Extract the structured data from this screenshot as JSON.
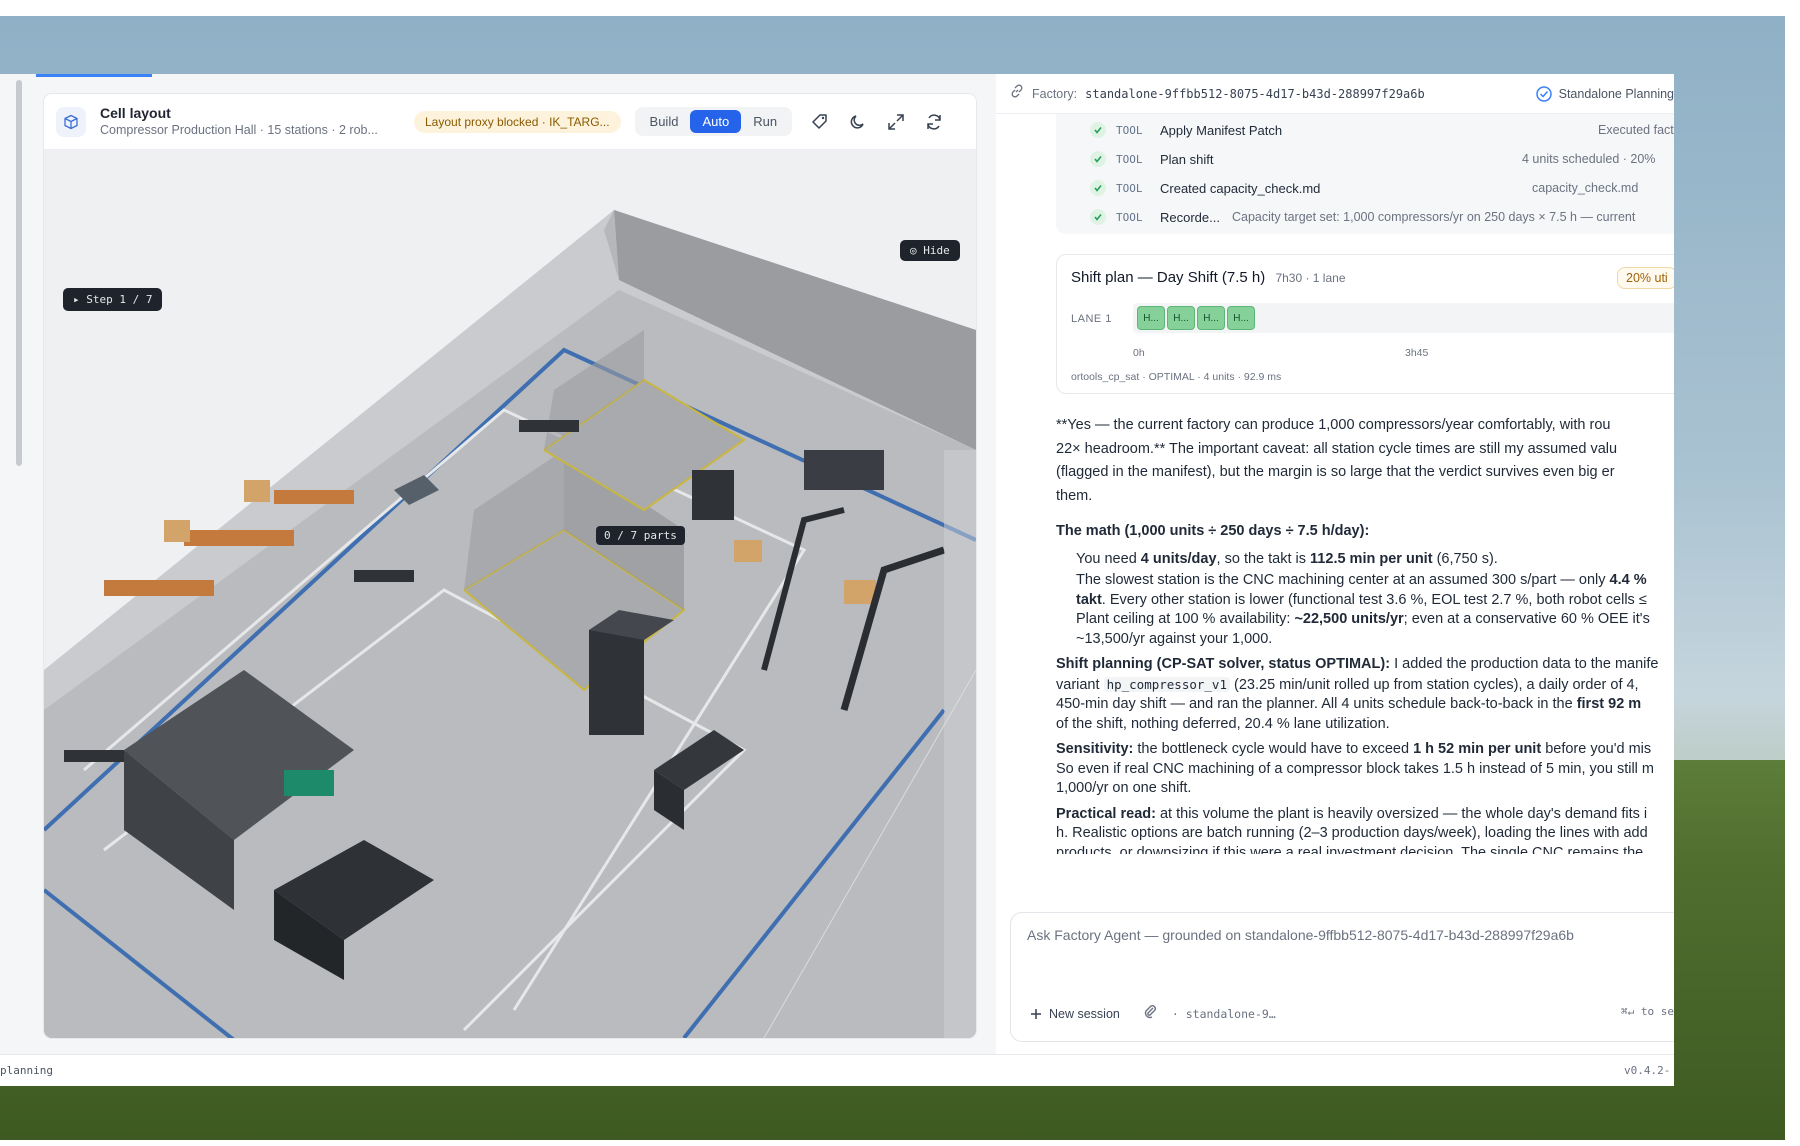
{
  "cell_layout": {
    "title": "Cell layout",
    "subtitle": "Compressor Production Hall · 15 stations · 2 rob...",
    "proxy_badge": "Layout proxy blocked · IK_TARG...",
    "modes": [
      "Build",
      "Auto",
      "Run"
    ],
    "active_mode": "Auto",
    "hide_label": "◎ Hide",
    "step_label": "▸ Step 1 / 7",
    "parts_label": "0 / 7 parts",
    "header_icons": [
      "tag-icon",
      "moon-icon",
      "expand-icon",
      "refresh-icon"
    ]
  },
  "chat": {
    "factory_label": "Factory:",
    "factory_id": "standalone-9ffbb512-8075-4d17-b43d-288997f29a6b",
    "mode_badge": "Standalone Planning",
    "tools": [
      {
        "tag": "TOOL",
        "name": "Apply Manifest Patch",
        "meta": "Executed facto"
      },
      {
        "tag": "TOOL",
        "name": "Plan shift",
        "meta": "4 units scheduled · 20%"
      },
      {
        "tag": "TOOL",
        "name": "Created capacity_check.md",
        "meta": "capacity_check.md"
      },
      {
        "tag": "TOOL",
        "name": "Recorde...",
        "meta": "Capacity target set: 1,000 compressors/yr on 250 days × 7.5 h — current"
      }
    ],
    "shift_plan": {
      "title": "Shift plan — Day Shift (7.5 h)",
      "subtitle": "7h30 · 1 lane",
      "util_badge": "20% uti",
      "lane_label": "LANE 1",
      "blocks": [
        "H...",
        "H...",
        "H...",
        "H..."
      ],
      "ticks": [
        "0h",
        "3h45"
      ],
      "solver": "ortools_cp_sat · OPTIMAL · 4 units · 92.9 ms"
    },
    "message": {
      "p1_l1": "**Yes — the current factory can produce 1,000 compressors/year comfortably, with rou",
      "p1_l2": "22× headroom.** The important caveat: all station cycle times are still my assumed valu",
      "p1_l3": "(flagged in the manifest), but the margin is so large that the verdict survives even big er",
      "p1_l4": "them.",
      "math_heading": "The math (1,000 units ÷ 250 days ÷ 7.5 h/day):",
      "b1_pre": "You need ",
      "b1_b1": "4 units/day",
      "b1_mid": ", so the takt is ",
      "b1_b2": "112.5 min per unit",
      "b1_post": " (6,750 s).",
      "b2_l1_pre": "The slowest station is the CNC machining center at an assumed 300 s/part — only ",
      "b2_l1_b": "4.4 %",
      "b2_l2_b": "takt",
      "b2_l2_post": ". Every other station is lower (functional test 3.6 %, EOL test 2.7 %, both robot cells ≤",
      "b3_l1_pre": "Plant ceiling at 100 % availability: ",
      "b3_l1_b": "~22,500 units/yr",
      "b3_l1_post": "; even at a conservative 60 % OEE it's",
      "b3_l2": "~13,500/yr against your 1,000.",
      "sp_b": "Shift planning (CP-SAT solver, status OPTIMAL):",
      "sp_l1_post": " I added the production data to the manife",
      "sp_l2_pre": "variant ",
      "sp_l2_code": "hp_compressor_v1",
      "sp_l2_post": " (23.25 min/unit rolled up from station cycles), a daily order of 4,",
      "sp_l3_pre": "450-min day shift — and ran the planner. All 4 units schedule back-to-back in the ",
      "sp_l3_b": "first 92 m",
      "sp_l4": "of the shift, nothing deferred, 20.4 % lane utilization.",
      "sens_b": "Sensitivity:",
      "sens_l1_mid": " the bottleneck cycle would have to exceed ",
      "sens_l1_b": "1 h 52 min per unit",
      "sens_l1_post": " before you'd mis",
      "sens_l2": "So even if real CNC machining of a compressor block takes 1.5 h instead of 5 min, you still m",
      "sens_l3": "1,000/yr on one shift.",
      "pr_b": "Practical read:",
      "pr_l1_post": " at this volume the plant is heavily oversized — the whole day's demand fits i",
      "pr_l2": "h. Realistic options are batch running (2–3 production days/week), loading the lines with add",
      "pr_l3": "products, or downsizing if this were a real investment decision. The single CNC remains the"
    },
    "composer": {
      "placeholder": "Ask Factory Agent — grounded on standalone-9ffbb512-8075-4d17-b43d-288997f29a6b",
      "new_session": "New session",
      "session_id": "· standalone-9…",
      "shortcut": "⌘↵ to se"
    }
  },
  "status_bar": {
    "left": "planning",
    "version": "v0.4.2-"
  },
  "colors": {
    "accent": "#2563eb",
    "success": "#22a05a",
    "warning_bg": "#fdf3dc",
    "lane_block": "#86d19a"
  }
}
